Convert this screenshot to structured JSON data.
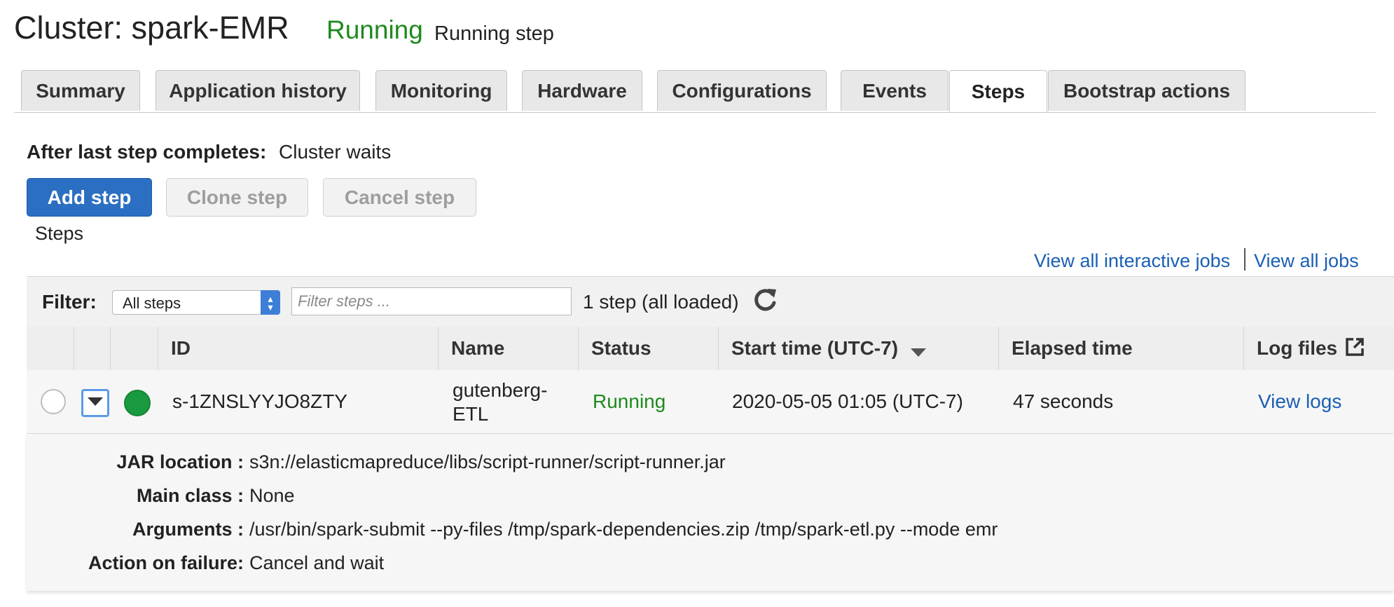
{
  "header": {
    "title": "Cluster: spark-EMR",
    "state": "Running",
    "substate": "Running step"
  },
  "tabs": [
    {
      "label": "Summary",
      "active": false
    },
    {
      "label": "Application history",
      "active": false
    },
    {
      "label": "Monitoring",
      "active": false
    },
    {
      "label": "Hardware",
      "active": false
    },
    {
      "label": "Configurations",
      "active": false
    },
    {
      "label": "Events",
      "active": false
    },
    {
      "label": "Steps",
      "active": true
    },
    {
      "label": "Bootstrap actions",
      "active": false
    }
  ],
  "after_last_step": {
    "label": "After last step completes:",
    "value": "Cluster waits"
  },
  "buttons": {
    "add": "Add step",
    "clone": "Clone step",
    "cancel": "Cancel step"
  },
  "steps_label": "Steps",
  "links": {
    "interactive_jobs": "View all interactive jobs",
    "all_jobs": "View all jobs"
  },
  "filter": {
    "label": "Filter:",
    "select_value": "All steps",
    "input_placeholder": "Filter steps ...",
    "count": "1 step (all loaded)"
  },
  "table": {
    "columns": {
      "id": "ID",
      "name": "Name",
      "status": "Status",
      "start_time": "Start time (UTC-7)",
      "elapsed": "Elapsed time",
      "log_files": "Log files"
    },
    "rows": [
      {
        "id": "s-1ZNSLYYJO8ZTY",
        "name_line1": "gutenberg-",
        "name_line2": "ETL",
        "status": "Running",
        "start_time": "2020-05-05 01:05 (UTC-7)",
        "elapsed": "47 seconds",
        "log_link": "View logs"
      }
    ]
  },
  "details": {
    "jar_label": "JAR location :",
    "jar_value": "s3n://elasticmapreduce/libs/script-runner/script-runner.jar",
    "main_class_label": "Main class :",
    "main_class_value": "None",
    "arguments_label": "Arguments :",
    "arguments_value": "/usr/bin/spark-submit --py-files /tmp/spark-dependencies.zip /tmp/spark-etl.py --mode emr",
    "failure_label": "Action on failure:",
    "failure_value": "Cancel and wait"
  },
  "colors": {
    "running": "#1d8a1d",
    "link": "#1a5fb4",
    "primary_button": "#2b6fc2",
    "status_dot": "#1a9a3e"
  },
  "icons": {
    "refresh": "refresh-icon",
    "sort": "sort-desc-icon",
    "external": "external-link-icon",
    "expand": "chevron-down-icon"
  }
}
